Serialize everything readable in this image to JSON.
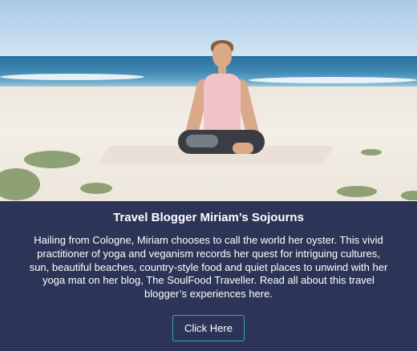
{
  "card": {
    "title": "Travel Blogger Miriam’s Sojourns",
    "description": "Hailing from Cologne, Miriam chooses to call the world her oyster. This vivid practitioner of yoga and veganism records her quest for intriguing cultures, sun, beautiful beaches, country-style food and quiet places to unwind with her yoga mat on her blog, The SoulFood Traveller. Read all about this travel blogger’s experiences here.",
    "cta_label": "Click Here"
  },
  "colors": {
    "panel_background": "#2c3558",
    "button_border": "#3aa9b3",
    "text": "#ffffff"
  }
}
